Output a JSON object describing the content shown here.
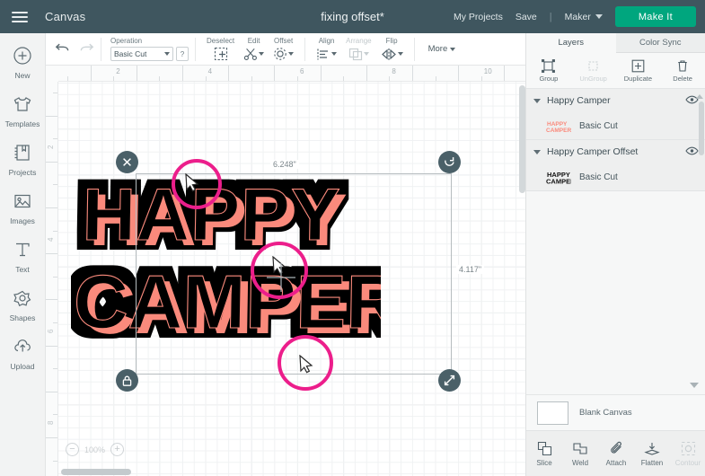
{
  "header": {
    "menu_icon": "hamburger-icon",
    "canvas_label": "Canvas",
    "project_title": "fixing offset*",
    "my_projects": "My Projects",
    "save": "Save",
    "separator": "|",
    "machine": "Maker",
    "make_it": "Make It",
    "accent_green": "#00a67e",
    "bar_color": "#3f565f"
  },
  "rail": {
    "items": [
      {
        "label": "New",
        "icon": "plus-circle-icon"
      },
      {
        "label": "Templates",
        "icon": "tshirt-icon"
      },
      {
        "label": "Projects",
        "icon": "book-icon"
      },
      {
        "label": "Images",
        "icon": "image-icon"
      },
      {
        "label": "Text",
        "icon": "text-t-icon"
      },
      {
        "label": "Shapes",
        "icon": "shapes-icon"
      },
      {
        "label": "Upload",
        "icon": "upload-cloud-icon"
      }
    ]
  },
  "toolbar": {
    "undo": "undo-icon",
    "redo": "redo-icon",
    "operation_label": "Operation",
    "operation_value": "Basic Cut",
    "operation_help": "?",
    "tools": [
      {
        "label": "Deselect",
        "icon": "deselect-icon",
        "disabled": false,
        "caret": false
      },
      {
        "label": "Edit",
        "icon": "edit-scissors-icon",
        "disabled": false,
        "caret": true
      },
      {
        "label": "Offset",
        "icon": "offset-icon",
        "disabled": false,
        "caret": true
      },
      {
        "label": "Align",
        "icon": "align-icon",
        "disabled": false,
        "caret": true
      },
      {
        "label": "Arrange",
        "icon": "arrange-icon",
        "disabled": true,
        "caret": true
      },
      {
        "label": "Flip",
        "icon": "flip-icon",
        "disabled": false,
        "caret": true
      }
    ],
    "more": "More"
  },
  "canvas": {
    "ruler_h_labels": [
      "2",
      "4",
      "6",
      "8",
      "10"
    ],
    "ruler_v_labels": [
      "2",
      "4",
      "6",
      "8"
    ],
    "width_label": "6.248\"",
    "height_label": "4.117\"",
    "zoom_out": "−",
    "zoom_value": "100%",
    "zoom_in": "+",
    "handles": {
      "delete": "close-x-icon",
      "rotate": "rotate-icon",
      "lock": "lock-icon",
      "resize": "resize-diagonal-icon"
    },
    "artwork": {
      "line1": "HAPPY",
      "line2": "CAMPER",
      "fill_color": "#fa8a7c",
      "offset_color": "#000000"
    },
    "annotation_color": "#ec1e8b"
  },
  "right_panel": {
    "tabs": [
      {
        "label": "Layers",
        "active": true
      },
      {
        "label": "Color Sync",
        "active": false
      }
    ],
    "actions": [
      {
        "label": "Group",
        "icon": "group-icon",
        "disabled": false
      },
      {
        "label": "UnGroup",
        "icon": "ungroup-icon",
        "disabled": true
      },
      {
        "label": "Duplicate",
        "icon": "duplicate-icon",
        "disabled": false
      },
      {
        "label": "Delete",
        "icon": "trash-icon",
        "disabled": false
      }
    ],
    "layers": [
      {
        "name": "Happy Camper",
        "child_label": "Basic Cut",
        "thumb_color": "#fa8a7c",
        "visibility_icon": "eye-icon"
      },
      {
        "name": "Happy Camper Offset",
        "child_label": "Basic Cut",
        "thumb_color": "#111111",
        "visibility_icon": "eye-icon"
      }
    ],
    "canvas_row": {
      "swatch_color": "#ffffff",
      "label": "Blank Canvas"
    },
    "bottom_tools": [
      {
        "label": "Slice",
        "icon": "slice-icon",
        "disabled": false
      },
      {
        "label": "Weld",
        "icon": "weld-icon",
        "disabled": false
      },
      {
        "label": "Attach",
        "icon": "attach-paperclip-icon",
        "disabled": false
      },
      {
        "label": "Flatten",
        "icon": "flatten-icon",
        "disabled": false
      },
      {
        "label": "Contour",
        "icon": "contour-icon",
        "disabled": true
      }
    ]
  }
}
